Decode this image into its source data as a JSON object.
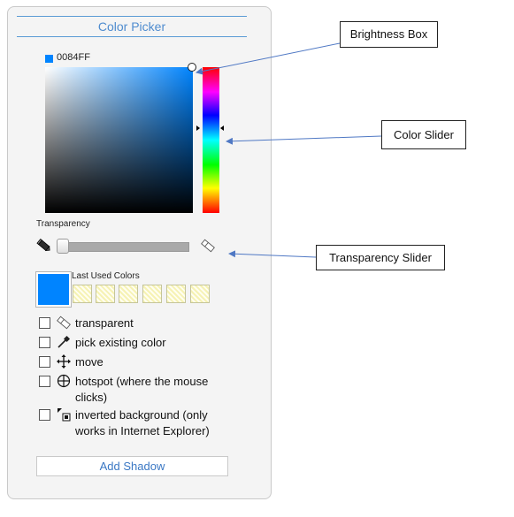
{
  "panel": {
    "title": "Color Picker",
    "hex_value": "0084FF",
    "current_color": "#0084FF",
    "transparency_label": "Transparency",
    "transparency_value": 0,
    "last_used_label": "Last Used Colors",
    "options": [
      {
        "label": "transparent",
        "icon": "eraser-icon",
        "checked": false
      },
      {
        "label": "pick existing color",
        "icon": "eyedropper-icon",
        "checked": false
      },
      {
        "label": "move",
        "icon": "move-arrows-icon",
        "checked": false
      },
      {
        "label": "hotspot (where the mouse clicks)",
        "icon": "crosshair-icon",
        "checked": false
      },
      {
        "label": "inverted background (only works in Internet Explorer)",
        "icon": "inverted-background-icon",
        "checked": false
      }
    ],
    "add_shadow_label": "Add Shadow"
  },
  "callouts": {
    "brightness_box": "Brightness Box",
    "color_slider": "Color Slider",
    "transparency_slider": "Transparency Slider"
  },
  "colors": {
    "accent": "#4f8ccf",
    "selected": "#0084FF",
    "panel_bg": "#f4f4f4",
    "leader_line": "#4f78c4"
  }
}
